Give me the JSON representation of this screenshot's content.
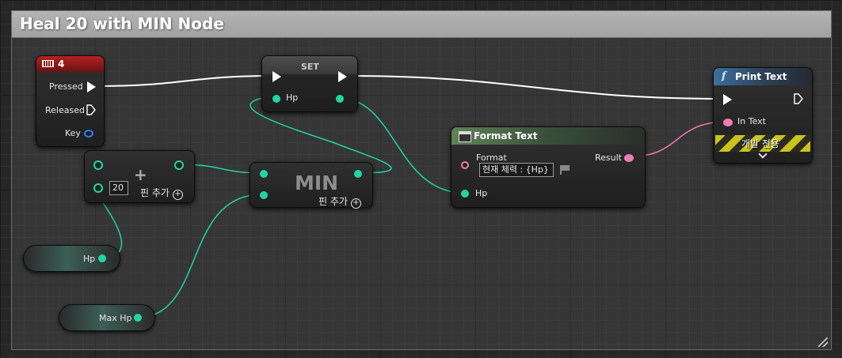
{
  "comment": {
    "title": "Heal 20 with MIN Node"
  },
  "key_event": {
    "title": "4",
    "pins": {
      "pressed": "Pressed",
      "released": "Released",
      "key": "Key"
    }
  },
  "set_node": {
    "title": "SET",
    "pin_hp": "Hp"
  },
  "add_node": {
    "symbol": "+",
    "value": "20",
    "add_pin": "핀 추가"
  },
  "min_node": {
    "title": "MIN",
    "add_pin": "핀 추가"
  },
  "hp_getter": {
    "label": "Hp"
  },
  "maxhp_getter": {
    "label": "Max Hp"
  },
  "format_text": {
    "title": "Format Text",
    "format_label": "Format",
    "format_value": "현재 체력 : {Hp}",
    "result_label": "Result",
    "hp_label": "Hp"
  },
  "print_text": {
    "icon": "f",
    "title": "Print Text",
    "in_text": "In Text",
    "dev_only": "개발 전용"
  },
  "colors": {
    "exec": "#ffffff",
    "float": "#1fd6a2",
    "text": "#f07db2",
    "struct": "#2f7df6",
    "event_header": "#9b1a1a",
    "function_header": "#2f4f6e",
    "pure_header": "#4a6a3a"
  }
}
